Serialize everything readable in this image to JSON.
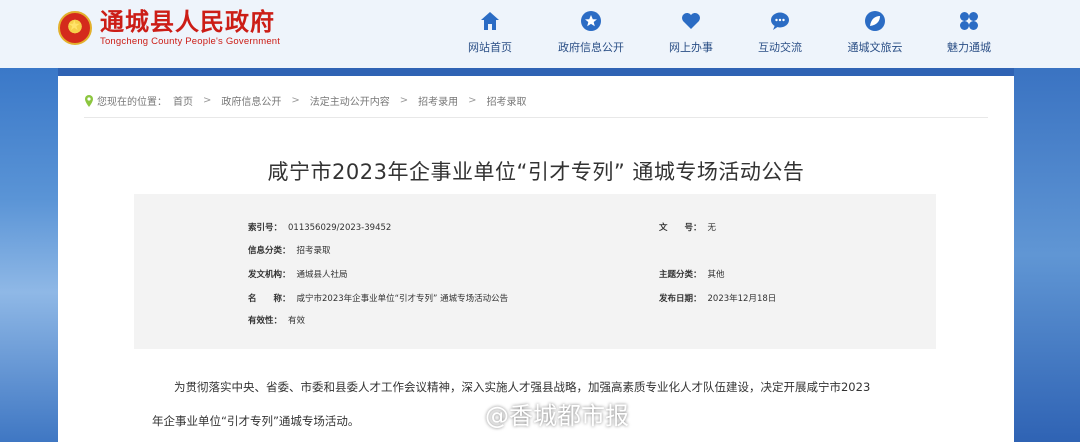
{
  "header": {
    "site_name": "通城县人民政府",
    "site_name_en": "Tongcheng County People's Government",
    "nav": [
      {
        "label": "网站首页",
        "icon": "home-icon"
      },
      {
        "label": "政府信息公开",
        "icon": "star-icon"
      },
      {
        "label": "网上办事",
        "icon": "heart-icon"
      },
      {
        "label": "互动交流",
        "icon": "chat-icon"
      },
      {
        "label": "通城文旅云",
        "icon": "leaf-icon"
      },
      {
        "label": "魅力通城",
        "icon": "grid-icon"
      }
    ]
  },
  "breadcrumb": {
    "prefix": "您现在的位置：",
    "items": [
      "首页",
      "政府信息公开",
      "法定主动公开内容",
      "招考录用",
      "招考录取"
    ]
  },
  "article": {
    "title": "咸宁市2023年企事业单位“引才专列” 通城专场活动公告",
    "meta": {
      "index_label": "索引号：",
      "index_value": "011356029/2023-39452",
      "docno_label": "文　　号：",
      "docno_value": "无",
      "category_label": "信息分类：",
      "category_value": "招考录取",
      "issuer_label": "发文机构：",
      "issuer_value": "通城县人社局",
      "topic_label": "主题分类：",
      "topic_value": "其他",
      "name_label": "名　　称：",
      "name_value": "咸宁市2023年企事业单位“引才专列” 通城专场活动公告",
      "date_label": "发布日期：",
      "date_value": "2023年12月18日",
      "validity_label": "有效性：",
      "validity_value": "有效"
    },
    "body_line1": "为贯彻落实中央、省委、市委和县委人才工作会议精神，深入实施人才强县战略，加强高素质专业化人才队伍建设，决定开展咸宁市2023",
    "body_line2": "年企事业单位“引才专列”通城专场活动。"
  },
  "watermark": "@香城都市报",
  "colors": {
    "brand_red": "#cc1d16",
    "nav_blue": "#2b6cc4",
    "page_blue": "#2f63b4"
  }
}
